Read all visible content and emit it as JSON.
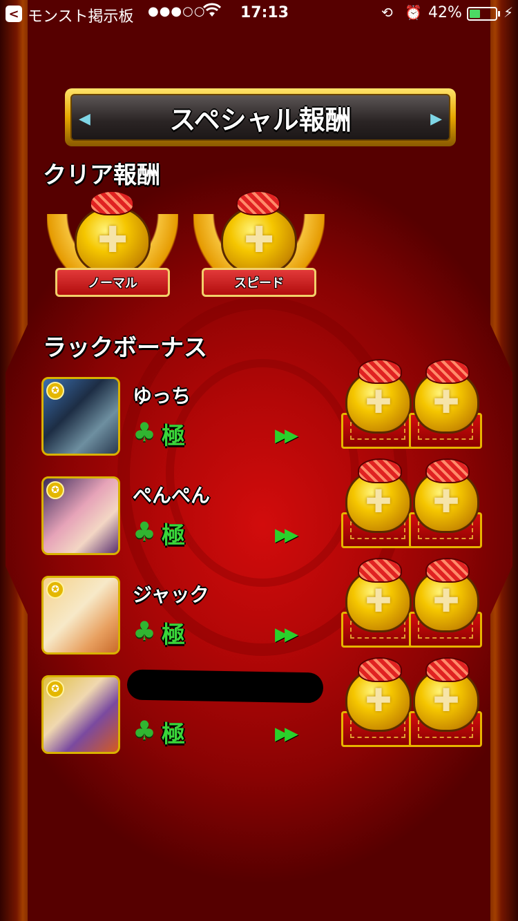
{
  "status_bar": {
    "back_label": "<",
    "app_name": "モンスト掲示板",
    "signal": "●●●○○",
    "wifi_icon": "wifi-icon",
    "time": "17:13",
    "battery_percent": "42%",
    "battery_level": 0.42
  },
  "header": {
    "title": "スペシャル報酬"
  },
  "clear_rewards": {
    "title": "クリア報酬",
    "items": [
      {
        "label": "ノーマル"
      },
      {
        "label": "スピード"
      }
    ]
  },
  "luck_bonus": {
    "title": "ラックボーナス",
    "players": [
      {
        "name": "ゆっち",
        "rank": "極",
        "reward_icons": [
          "gift-egg-icon",
          "gift-egg-icon"
        ]
      },
      {
        "name": "ぺんぺん",
        "rank": "極",
        "reward_icons": [
          "gift-egg-icon",
          "gift-egg-icon"
        ]
      },
      {
        "name": "ジャック",
        "rank": "極",
        "reward_icons": [
          "gift-egg-icon",
          "gift-egg-icon"
        ]
      },
      {
        "name": "",
        "rank": "極",
        "redacted": true,
        "reward_icons": [
          "gift-egg-icon",
          "gift-egg-icon"
        ]
      }
    ]
  },
  "colors": {
    "background": "#b30707",
    "gold": "#e6a600",
    "luck_green": "#3ad63a"
  }
}
